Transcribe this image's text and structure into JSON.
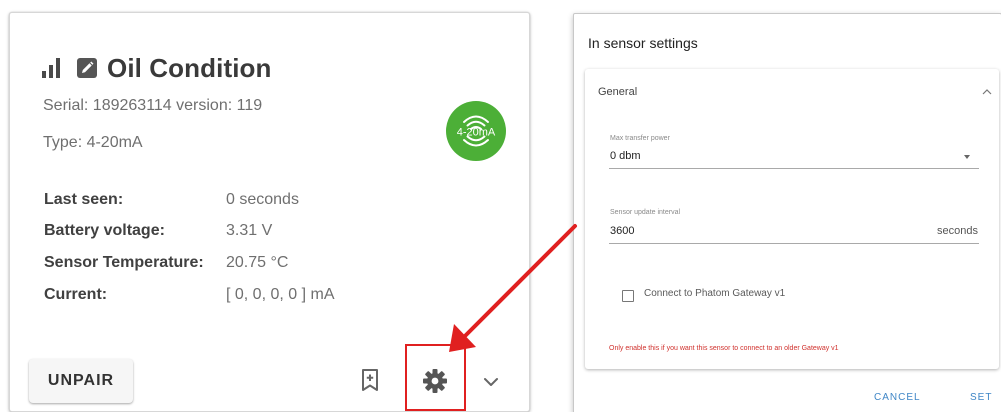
{
  "card": {
    "title": "Oil Condition",
    "serial": "Serial: 189263114 version: 119",
    "type": "Type: 4-20mA",
    "badge_text": "4-20mA",
    "badge_color": "#4caf37",
    "rows": [
      {
        "label": "Last seen:",
        "value": "0 seconds"
      },
      {
        "label": "Battery voltage:",
        "value": "3.31 V"
      },
      {
        "label": "Sensor Temperature:",
        "value": "20.75 °C"
      },
      {
        "label": "Current:",
        "value": "[ 0, 0, 0, 0 ] mA"
      }
    ],
    "unpair_label": "UNPAIR",
    "icons": [
      "signal-icon",
      "edit-icon",
      "bookmark-add-icon",
      "gear-icon",
      "chevron-down-icon"
    ]
  },
  "dialog": {
    "title": "In sensor settings",
    "panel_title": "General",
    "fields": {
      "max_transfer_power": {
        "label": "Max transfer power",
        "value": "0 dbm"
      },
      "update_interval": {
        "label": "Sensor update interval",
        "value": "3600",
        "suffix": "seconds"
      }
    },
    "checkbox_label": "Connect to Phatom Gateway v1",
    "checkbox_checked": false,
    "warning": "Only enable this if you want this sensor to connect to an older Gateway v1",
    "cancel_label": "CANCEL",
    "set_label": "SET",
    "accent_color": "#3f86c6",
    "warning_color": "#d0312d"
  },
  "annotation": {
    "highlight_color": "#e02020"
  }
}
